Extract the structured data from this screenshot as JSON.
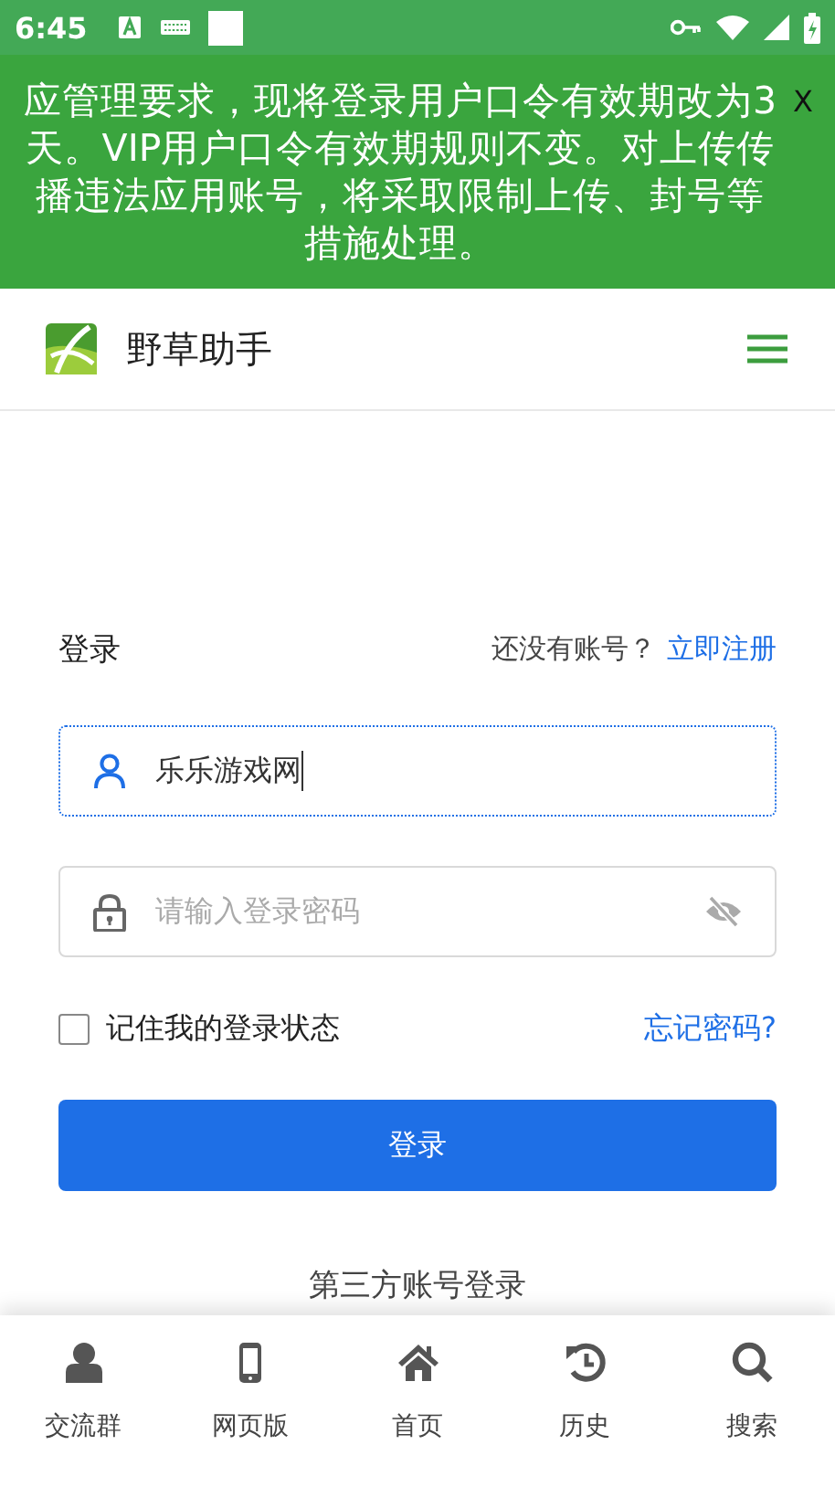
{
  "status_bar": {
    "time": "6:45"
  },
  "notice": {
    "text": "应管理要求，现将登录用户口令有效期改为3天。VIP用户口令有效期规则不变。对上传传播违法应用账号，将采取限制上传、封号等措施处理。",
    "close": "X"
  },
  "header": {
    "title": "野草助手"
  },
  "login": {
    "title": "登录",
    "signup_prompt": "还没有账号？",
    "signup_link": "立即注册",
    "username": {
      "value": "乐乐游戏网",
      "focused": true
    },
    "password": {
      "placeholder": "请输入登录密码",
      "visible": false
    },
    "remember": {
      "label": "记住我的登录状态",
      "checked": false
    },
    "forgot": "忘记密码?",
    "submit": "登录",
    "third_party": "第三方账号登录"
  },
  "bottom_nav": [
    {
      "label": "交流群"
    },
    {
      "label": "网页版"
    },
    {
      "label": "首页"
    },
    {
      "label": "历史"
    },
    {
      "label": "搜索"
    }
  ]
}
